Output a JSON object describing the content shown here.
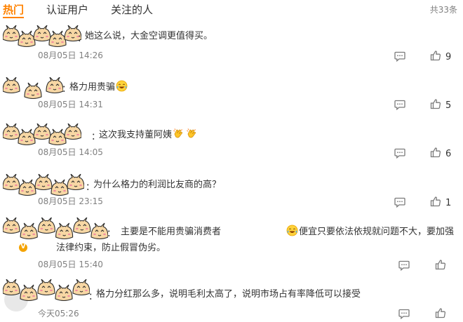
{
  "tabs": {
    "hot": "热门",
    "verified": "认证用户",
    "following": "关注的人"
  },
  "total_count": "共33条",
  "comments": [
    {
      "text": "她这么说，大金空调更值得买。",
      "time": "08月05日 14:26",
      "likes": "9"
    },
    {
      "text": "格力用贵骗",
      "time": "08月05日 14:31",
      "likes": "5"
    },
    {
      "text": "这次我支持董阿姨",
      "time": "08月05日 14:05",
      "likes": "6"
    },
    {
      "text": "为什么格力的利润比友商的高？",
      "time": "08月05日 23:15",
      "likes": "1"
    },
    {
      "text_a": "主要是不能用贵骗消费者",
      "text_b": "便宜只要依法依规就问题不大，要加强法律约束，防止假冒伪劣。",
      "time": "08月05日 15:40"
    },
    {
      "text": "格力分红那么多，说明毛利太高了，说明市场占有率降低可以接受",
      "time": "今天05:26"
    }
  ],
  "separator": "：",
  "verified_badge": "V",
  "icons": {
    "reply": "comment-icon",
    "like": "thumbs-up-icon",
    "laugh_cry": "laugh-cry-emoji",
    "clap": "clap-emoji"
  },
  "colors": {
    "accent": "#ff8200",
    "muted": "#808080",
    "text": "#333333"
  }
}
